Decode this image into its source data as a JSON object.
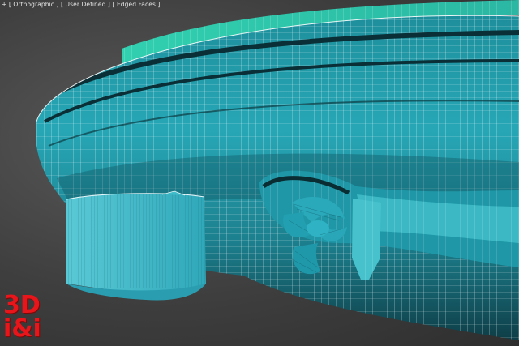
{
  "viewport": {
    "label_plus": "+",
    "label_view": "[ Orthographic ]",
    "label_shading": "[ User Defined ]",
    "label_display": "[ Edged Faces ]"
  },
  "logo": {
    "line1": "3D",
    "line2": "i&i"
  },
  "colors": {
    "hull": "#2fb8c6",
    "hull_dark": "#0d3c44",
    "deck_edge": "#38c9a8",
    "wire": "#ffffff",
    "background": "#474747",
    "logo_red": "#e8161a"
  }
}
